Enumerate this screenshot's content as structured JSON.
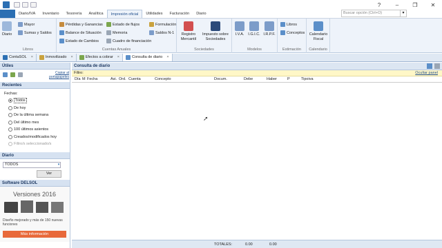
{
  "menu": [
    "Diario/IVA",
    "Inventario",
    "Tesorería",
    "Analítica",
    "Impresión oficial",
    "Utilidades",
    "Facturación",
    "Diario"
  ],
  "search_placeholder": "Buscar opción (Ctrl+O)",
  "ribbon": {
    "libros_group": "Libros",
    "diario": "Diario",
    "mayor": "Mayor",
    "sumas": "Sumas y Saldos",
    "perdidas": "Pérdidas y Ganancias",
    "balance": "Balance de Situación",
    "cambios": "Estado de Cambios",
    "flujos": "Estado de flujos",
    "memoria": "Memoria",
    "cuadro": "Cuadro de financiación",
    "formulacion": "Formulación",
    "saldosn": "Saldos N-1",
    "cuentas_group": "Cuentas Anuales",
    "registro": "Registro Mercantil",
    "impuesto": "Impuesto sobre Sociedades",
    "sociedades_group": "Sociedades",
    "iva": "I.V.A.",
    "irpf_mod": "I.R.P.F.",
    "igic": "I.G.I.C.",
    "modelos_group": "Modelos",
    "libros": "Libros",
    "conceptos": "Conceptos",
    "estimacion_group": "Estimación",
    "calendario": "Calendario Fiscal",
    "calendario_group": "Calendario"
  },
  "tabs": [
    "ContaSOL",
    "Inmovilizado",
    "Efectos a cobrar",
    "Consulta de diario"
  ],
  "left": {
    "utiles": "Útiles",
    "copiar": "Copiar al portapapeles",
    "recientes": "Recientes",
    "fechas": "Fechas:",
    "options": [
      "Todos",
      "De hoy",
      "De la última semana",
      "Del último mes",
      "100 últimos asientos",
      "Creados/modificados hoy",
      "Filtro/s seleccionado/s"
    ],
    "diario_head": "Diario",
    "diario_value": "TODOS",
    "ver": "Ver",
    "software": "Software DELSOL",
    "versiones": "Versiones 2016",
    "promo": "Diseño mejorado y más de 150 nuevas funciones",
    "mas_info": "Más información"
  },
  "main": {
    "title": "Consulta de diario",
    "filtro": "Filtro:",
    "ocultar": "Ocultar panel",
    "cols": [
      "Día",
      "M",
      "Fecha",
      "Asi.",
      "Ord.",
      "Cuenta",
      "Concepto",
      "Docum.",
      "Debe",
      "Haber",
      "P",
      "Tipoiva"
    ],
    "totales": "TOTALES:",
    "debe_total": "0.00",
    "haber_total": "0.00"
  }
}
